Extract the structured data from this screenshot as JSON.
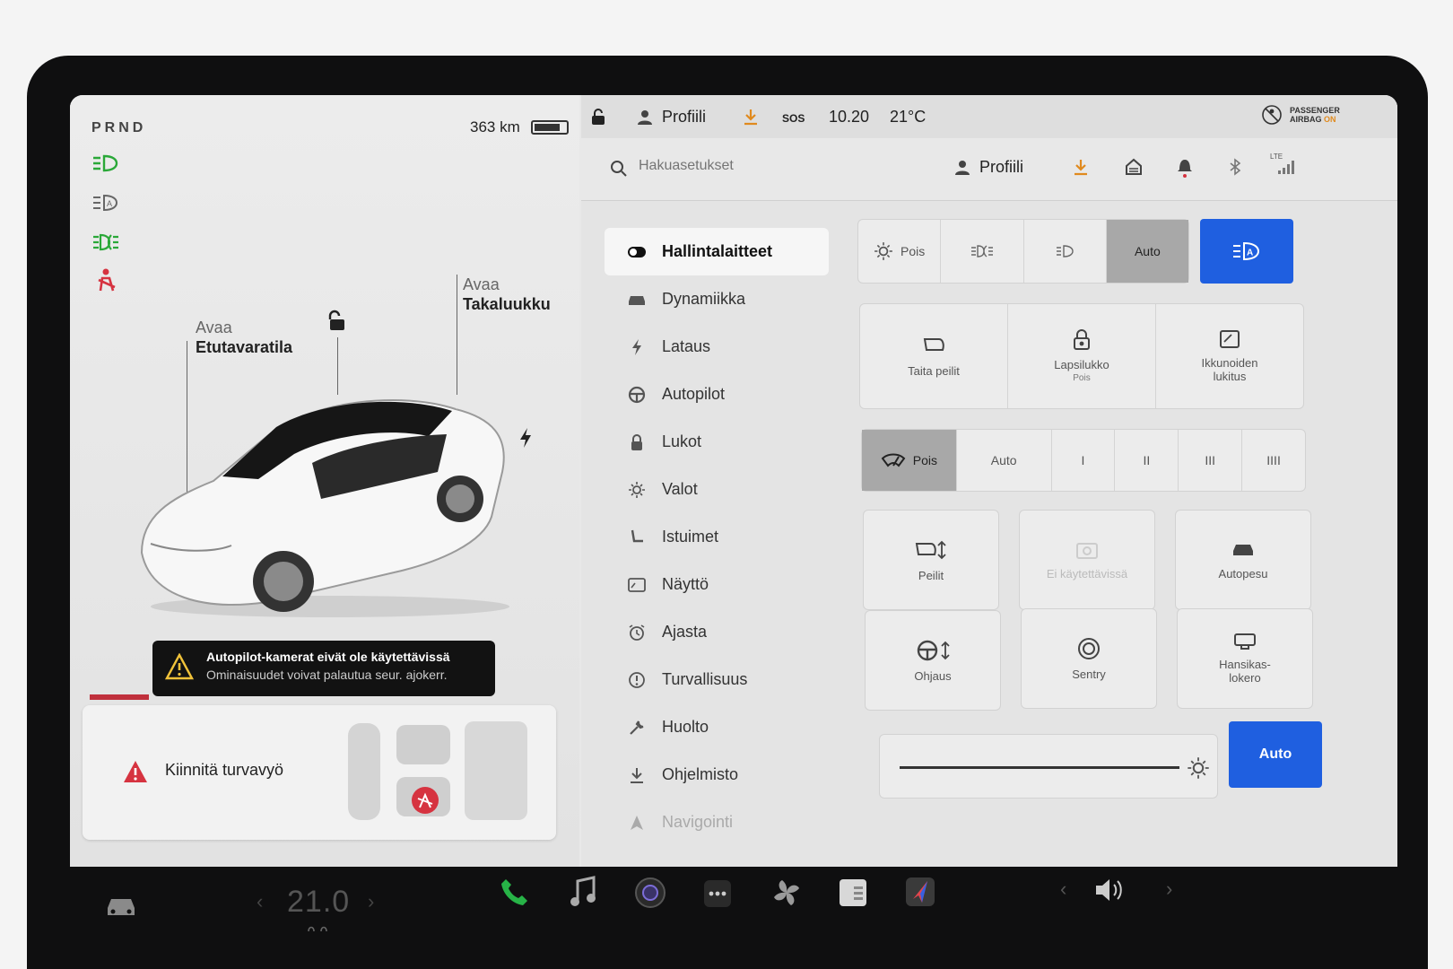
{
  "status": {
    "gear": "PRND",
    "range": "363 km",
    "profile": "Profiili",
    "sos": "SOS",
    "time": "10.20",
    "temperature": "21°C",
    "passenger_airbag_line1": "PASSENGER",
    "passenger_airbag_line2": "AIRBAG",
    "passenger_airbag_state": "ON",
    "lte": "LTE"
  },
  "car_panel": {
    "frunk_action": "Avaa",
    "frunk_label": "Etutavaratila",
    "trunk_action": "Avaa",
    "trunk_label": "Takaluukku",
    "alert_title": "Autopilot-kamerat eivät ole käytettävissä",
    "alert_body": "Ominaisuudet voivat palautua seur. ajokerr.",
    "seatbelt_warning": "Kiinnitä turvavyö"
  },
  "search": {
    "placeholder": "Hakuasetukset",
    "profile": "Profiili"
  },
  "nav": {
    "items": [
      {
        "label": "Hallintalaitteet",
        "icon": "toggle-icon"
      },
      {
        "label": "Dynamiikka",
        "icon": "car-icon"
      },
      {
        "label": "Lataus",
        "icon": "bolt-icon"
      },
      {
        "label": "Autopilot",
        "icon": "steering-wheel-icon"
      },
      {
        "label": "Lukot",
        "icon": "lock-icon"
      },
      {
        "label": "Valot",
        "icon": "sun-icon"
      },
      {
        "label": "Istuimet",
        "icon": "seat-icon"
      },
      {
        "label": "Näyttö",
        "icon": "display-icon"
      },
      {
        "label": "Ajasta",
        "icon": "alarm-clock-icon"
      },
      {
        "label": "Turvallisuus",
        "icon": "info-circle-icon"
      },
      {
        "label": "Huolto",
        "icon": "wrench-icon"
      },
      {
        "label": "Ohjelmisto",
        "icon": "download-icon"
      },
      {
        "label": "Navigointi",
        "icon": "navigation-icon"
      }
    ]
  },
  "lights": {
    "off": "Pois",
    "auto": "Auto"
  },
  "tiles_row1": {
    "fold_mirrors": "Taita peilit",
    "child_lock": "Lapsilukko",
    "child_lock_state": "Pois",
    "window_lock_1": "Ikkunoiden",
    "window_lock_2": "lukitus"
  },
  "wipers": {
    "off": "Pois",
    "auto": "Auto",
    "speeds": [
      "I",
      "II",
      "III",
      "IIII"
    ]
  },
  "tiles_grid": {
    "mirrors": "Peilit",
    "unavailable": "Ei käytettävissä",
    "car_wash": "Autopesu",
    "steering": "Ohjaus",
    "sentry": "Sentry",
    "glovebox_1": "Hansikas-",
    "glovebox_2": "lokero"
  },
  "brightness": {
    "auto": "Auto",
    "level": 0.95
  },
  "dock": {
    "temperature": "21.0"
  }
}
